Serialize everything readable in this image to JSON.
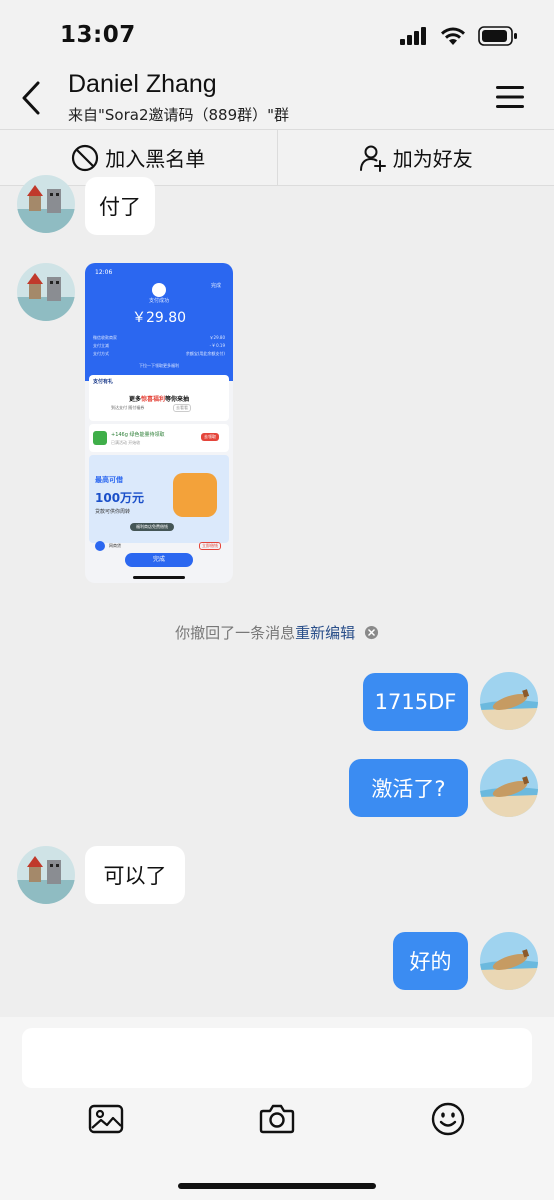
{
  "status_bar": {
    "time": "13:07"
  },
  "header": {
    "title": "Daniel Zhang",
    "subtitle": "来自\"Sora2邀请码（889群）\"群"
  },
  "actions": {
    "block_label": "加入黑名单",
    "add_friend_label": "加为好友"
  },
  "messages": {
    "m1": "付了",
    "m5": "1715DF",
    "m6": "激活了?",
    "m7": "可以了",
    "m8": "好的"
  },
  "receipt": {
    "time": "12:06",
    "status": "支付成功",
    "done_top": "完成",
    "amount": "￥29.80",
    "row1_label": "微信收款商家",
    "row1_value": "￥29.80",
    "row2_label": "支付立减",
    "row2_value": "- ¥ 0.19",
    "row3_label": "支付方式",
    "row3_value": "余额宝(用此余额支付)",
    "more": "下拉一下领取更多福利",
    "promo_title": "支付有礼",
    "promo_line_a": "更多",
    "promo_line_hl": "惊喜福利",
    "promo_line_b": "等你来抽",
    "promo_sub": "到达支付  随付福券",
    "promo_tag": "去看看",
    "energy": "+146g 绿色能量待领取",
    "energy_sub": "已满活动  开始收",
    "energy_btn": "去领取",
    "loan_title": "最高可借",
    "loan_amount": "100万元",
    "loan_sub": "贷款可供你周转",
    "loan_bar": "福利商店免费借钱",
    "foot_label": "网商贷",
    "foot_btn": "立即借钱",
    "done_bottom": "完成"
  },
  "recall": {
    "text": "你撤回了一条消息",
    "link": "重新编辑"
  },
  "colors": {
    "accent": "#3b8cf2",
    "link": "#2a4f8a",
    "receipt_blue": "#2b67f0"
  },
  "icons": [
    "back-arrow-icon",
    "menu-icon",
    "block-icon",
    "add-friend-icon",
    "image-icon",
    "camera-icon",
    "emoji-icon",
    "signal-icon",
    "wifi-icon",
    "battery-icon",
    "close-circle-icon"
  ]
}
